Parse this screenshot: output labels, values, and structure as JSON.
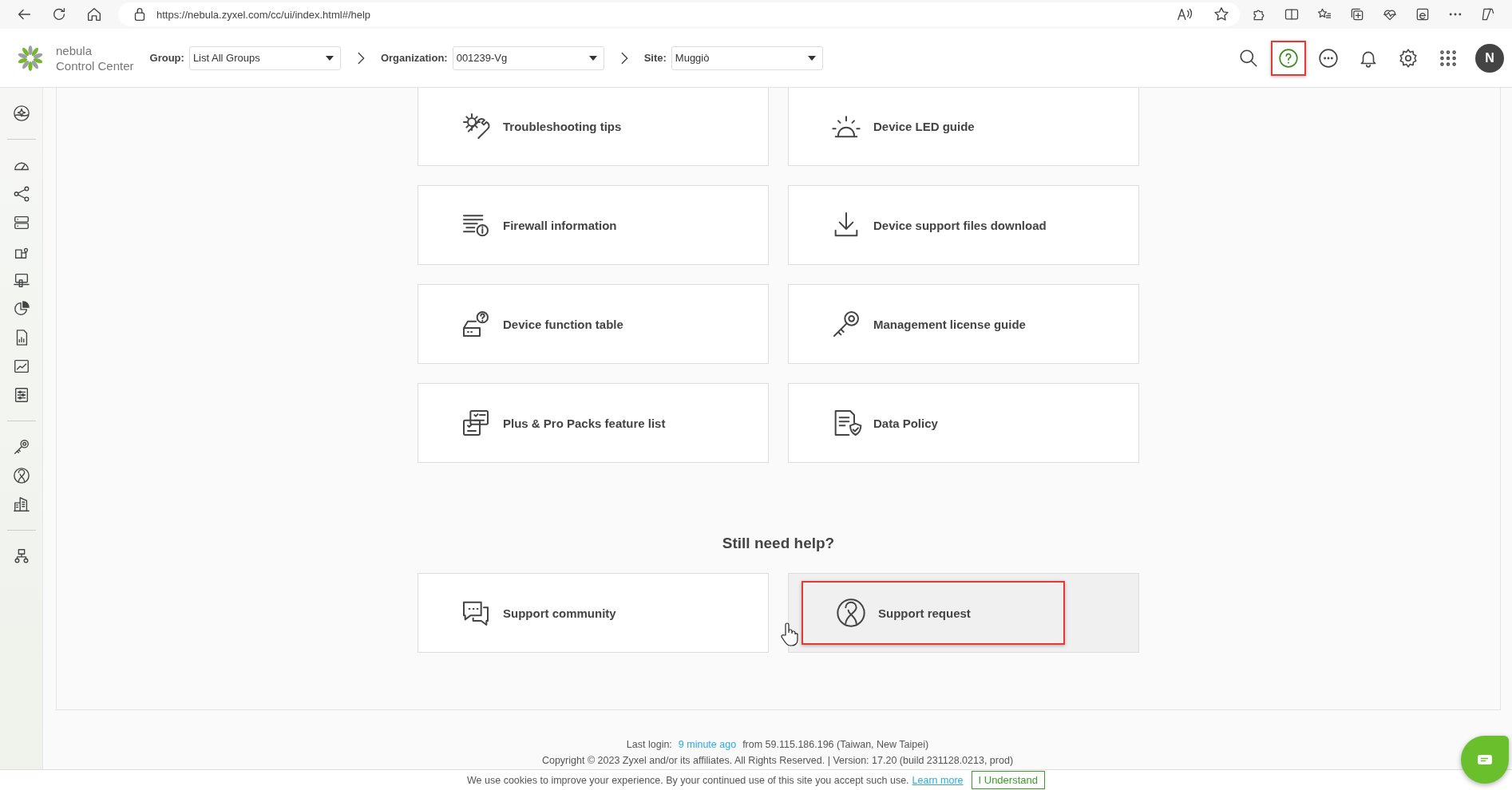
{
  "browser": {
    "url": "https://nebula.zyxel.com/cc/ui/index.html#/help",
    "nav_buttons": [
      {
        "kind": "back"
      },
      {
        "kind": "reload"
      },
      {
        "kind": "home"
      }
    ],
    "address_icons": [
      {
        "kind": "read-aloud"
      },
      {
        "kind": "star"
      }
    ],
    "toolbar_icons": [
      {
        "kind": "puzzle"
      },
      {
        "kind": "split"
      },
      {
        "kind": "favorites"
      },
      {
        "kind": "collections"
      },
      {
        "kind": "health"
      },
      {
        "kind": "e-page"
      },
      {
        "kind": "more"
      },
      {
        "kind": "copilot"
      }
    ]
  },
  "header": {
    "logo_lines": [
      "nebula",
      "Control Center"
    ],
    "filters": [
      {
        "label": "Group:",
        "value": "List All Groups"
      },
      {
        "label": "Organization:",
        "value": "001239-Vg"
      },
      {
        "label": "Site:",
        "value": "Muggiò"
      }
    ],
    "tools": [
      {
        "kind": "search",
        "highlighted": false
      },
      {
        "kind": "help",
        "highlighted": true
      },
      {
        "kind": "chat",
        "highlighted": false
      },
      {
        "kind": "bell",
        "highlighted": false
      },
      {
        "kind": "gear",
        "highlighted": false
      },
      {
        "kind": "apps",
        "highlighted": false
      }
    ],
    "avatar": "N"
  },
  "sidebar": {
    "items": [
      {
        "kind": "sparkle"
      },
      {
        "kind": "divider"
      },
      {
        "kind": "gauge"
      },
      {
        "kind": "share"
      },
      {
        "kind": "server"
      },
      {
        "kind": "map-pin"
      },
      {
        "kind": "devices"
      },
      {
        "kind": "pie"
      },
      {
        "kind": "report"
      },
      {
        "kind": "chart"
      },
      {
        "kind": "sliders"
      },
      {
        "kind": "divider"
      },
      {
        "kind": "key"
      },
      {
        "kind": "support"
      },
      {
        "kind": "building"
      },
      {
        "kind": "divider"
      },
      {
        "kind": "org"
      }
    ]
  },
  "cards": [
    {
      "title": "Troubleshooting tips",
      "kind": "tools"
    },
    {
      "title": "Device LED guide",
      "kind": "led"
    },
    {
      "title": "Firewall information",
      "kind": "firewall"
    },
    {
      "title": "Device support files download",
      "kind": "download"
    },
    {
      "title": "Device function table",
      "kind": "device-question"
    },
    {
      "title": "Management license guide",
      "kind": "key"
    },
    {
      "title": "Plus & Pro Packs feature list",
      "kind": "checklist"
    },
    {
      "title": "Data Policy",
      "kind": "doc-shield"
    }
  ],
  "help_heading": "Still need help?",
  "support_cards": [
    {
      "title": "Support community",
      "kind": "chat-bubbles",
      "hovered": false,
      "highlighted": false
    },
    {
      "title": "Support request",
      "kind": "support",
      "hovered": true,
      "highlighted": true
    }
  ],
  "footer": {
    "last_login_label": "Last login:",
    "last_login_link": "9 minute ago",
    "last_login_rest": "from 59.115.186.196 (Taiwan, New Taipei)",
    "copyright": "Copyright © 2023 Zyxel and/or its affiliates. All Rights Reserved. | Version: 17.20 (build 231128.0213, prod)"
  },
  "cookie_bar": {
    "text": "We use cookies to improve your experience. By your continued use of this site you accept such use.",
    "link": "Learn more",
    "button": "I Understand"
  }
}
